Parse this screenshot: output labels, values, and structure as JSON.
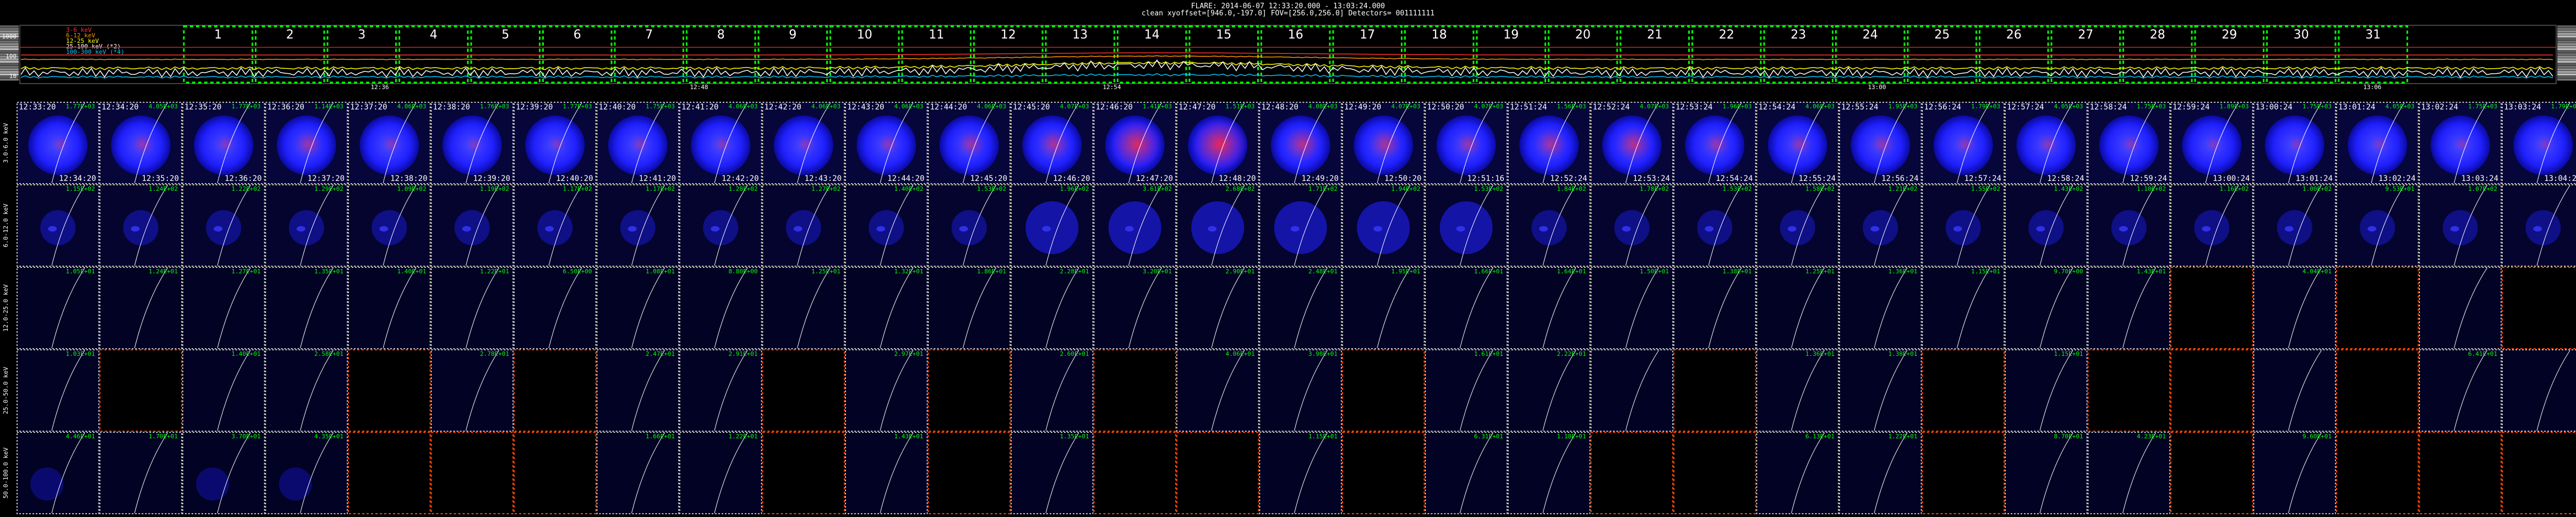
{
  "header": {
    "line1": "FLARE: 2014-06-07 12:33:20.000 - 13:03:24.000",
    "line2": "clean     xyoffset=[946.0,-197.0]    FOV=[256.0,256.0]     Detectors= 001111111"
  },
  "lightcurve": {
    "legend": [
      {
        "label": "3-6 keV",
        "color": "#ff3030"
      },
      {
        "label": "6-12 keV",
        "color": "#ff9000"
      },
      {
        "label": "12-25 keV",
        "color": "#ffff00"
      },
      {
        "label": "25-100 keV (*2)",
        "color": "#ffffff"
      },
      {
        "label": "100-300 keV (*4)",
        "color": "#00c8ff"
      }
    ],
    "y_ticks": [
      "1000",
      "100",
      "10"
    ],
    "x_ticks": [
      "12:36",
      "12:48",
      "12:54",
      "13:00",
      "13:06"
    ],
    "interval_labels": [
      "1",
      "2",
      "3",
      "4",
      "5",
      "6",
      "7",
      "8",
      "9",
      "10",
      "11",
      "12",
      "13",
      "14",
      "15",
      "16",
      "17",
      "18",
      "19",
      "20",
      "21",
      "22",
      "23",
      "24",
      "25",
      "26",
      "27",
      "28",
      "29",
      "30",
      "31"
    ]
  },
  "colors": {
    "interval_box": "#00ff00",
    "map_frame_data": "#ffffff",
    "map_frame_empty": "#ff4500",
    "peak_text": "#00ff00",
    "limb": "#ffffff"
  },
  "rows": [
    {
      "label": "3.0-6.0 keV"
    },
    {
      "label": "6.0-12.0 keV"
    },
    {
      "label": "12.0-25.0 keV"
    },
    {
      "label": "25.0-50.0 keV"
    },
    {
      "label": "50.0-100.0 keV"
    }
  ],
  "columns": [
    {
      "start": "12:33:20",
      "end": "12:34:20",
      "peaks": [
        "1.77E+03",
        "1.15E+02",
        "1.05E+01",
        "1.03E+01",
        "4.46E+01"
      ]
    },
    {
      "start": "12:34:20",
      "end": "12:35:20",
      "peaks": [
        "4.05E+03",
        "1.24E+02",
        "1.24E+01",
        "",
        "1.70E+01"
      ]
    },
    {
      "start": "12:35:20",
      "end": "12:36:20",
      "peaks": [
        "1.77E+03",
        "1.22E+02",
        "1.27E+01",
        "1.40E+01",
        "3.70E+01"
      ]
    },
    {
      "start": "12:36:20",
      "end": "12:37:20",
      "peaks": [
        "1.14E+03",
        "1.29E+02",
        "1.35E+01",
        "2.58E+01",
        "4.35E+01"
      ]
    },
    {
      "start": "12:37:20",
      "end": "12:38:20",
      "peaks": [
        "4.06E+03",
        "1.09E+02",
        "1.40E+01",
        "",
        "2.53E+01"
      ]
    },
    {
      "start": "12:38:20",
      "end": "12:39:20",
      "peaks": [
        "1.76E+03",
        "1.19E+02",
        "1.22E+01",
        "2.78E+01",
        ""
      ]
    },
    {
      "start": "12:39:20",
      "end": "12:40:20",
      "peaks": [
        "1.77E+03",
        "1.17E+02",
        "6.50E+00",
        "",
        ""
      ]
    },
    {
      "start": "12:40:20",
      "end": "12:41:20",
      "peaks": [
        "1.75E+03",
        "1.17E+02",
        "1.08E+01",
        "2.47E+01",
        "1.66E+01"
      ]
    },
    {
      "start": "12:41:20",
      "end": "12:42:20",
      "peaks": [
        "4.06E+03",
        "1.28E+02",
        "8.80E+00",
        "2.91E+01",
        "1.22E+01"
      ]
    },
    {
      "start": "12:42:20",
      "end": "12:43:20",
      "peaks": [
        "4.06E+03",
        "1.27E+02",
        "1.25E+01",
        "",
        ""
      ]
    },
    {
      "start": "12:43:20",
      "end": "12:44:20",
      "peaks": [
        "4.06E+03",
        "1.40E+02",
        "1.32E+01",
        "2.97E+01",
        "1.43E+01"
      ]
    },
    {
      "start": "12:44:20",
      "end": "12:45:20",
      "peaks": [
        "4.06E+03",
        "1.53E+02",
        "1.86E+01",
        "",
        ""
      ]
    },
    {
      "start": "12:45:20",
      "end": "12:46:20",
      "peaks": [
        "4.07E+03",
        "1.96E+02",
        "2.28E+01",
        "2.60E+01",
        "1.35E+01"
      ]
    },
    {
      "start": "12:46:20",
      "end": "12:47:20",
      "peaks": [
        "1.41E+03",
        "3.61E+02",
        "3.20E+01",
        "",
        ""
      ]
    },
    {
      "start": "12:47:20",
      "end": "12:48:20",
      "peaks": [
        "1.51E+03",
        "2.68E+02",
        "2.90E+01",
        "4.06E+01",
        ""
      ]
    },
    {
      "start": "12:48:20",
      "end": "12:49:20",
      "peaks": [
        "4.08E+03",
        "1.71E+02",
        "2.48E+01",
        "3.98E+01",
        "1.15E+01"
      ]
    },
    {
      "start": "12:49:20",
      "end": "12:50:20",
      "peaks": [
        "4.07E+03",
        "1.94E+02",
        "1.95E+01",
        "",
        ""
      ]
    },
    {
      "start": "12:50:20",
      "end": "12:51:16",
      "peaks": [
        "4.07E+03",
        "1.53E+02",
        "1.66E+01",
        "1.61E+01",
        "6.31E+01"
      ]
    },
    {
      "start": "12:51:24",
      "end": "12:52:24",
      "peaks": [
        "1.56E+03",
        "1.84E+02",
        "1.64E+01",
        "2.22E+01",
        "1.18E+01"
      ]
    },
    {
      "start": "12:52:24",
      "end": "12:53:24",
      "peaks": [
        "4.07E+03",
        "1.78E+02",
        "1.50E+01",
        "",
        ""
      ]
    },
    {
      "start": "12:53:24",
      "end": "12:54:24",
      "peaks": [
        "1.96E+03",
        "1.53E+02",
        "1.38E+01",
        "1.40E+01",
        ""
      ]
    },
    {
      "start": "12:54:24",
      "end": "12:55:24",
      "peaks": [
        "4.06E+03",
        "1.58E+02",
        "1.25E+01",
        "1.36E+01",
        "6.13E+01"
      ]
    },
    {
      "start": "12:55:24",
      "end": "12:56:24",
      "peaks": [
        "1.95E+03",
        "1.21E+02",
        "1.36E+01",
        "1.38E+01",
        "1.22E+01"
      ]
    },
    {
      "start": "12:56:24",
      "end": "12:57:24",
      "peaks": [
        "1.79E+03",
        "1.55E+02",
        "1.15E+01",
        "",
        ""
      ]
    },
    {
      "start": "12:57:24",
      "end": "12:58:24",
      "peaks": [
        "4.05E+03",
        "1.43E+02",
        "9.70E+00",
        "1.15E+01",
        "8.70E+01"
      ]
    },
    {
      "start": "12:58:24",
      "end": "12:59:24",
      "peaks": [
        "1.75E+03",
        "1.10E+02",
        "1.43E+01",
        "",
        "4.23E+01"
      ]
    },
    {
      "start": "12:59:24",
      "end": "13:00:24",
      "peaks": [
        "1.89E+03",
        "1.16E+02",
        "",
        "",
        ""
      ]
    },
    {
      "start": "13:00:24",
      "end": "13:01:24",
      "peaks": [
        "1.75E+03",
        "1.00E+02",
        "4.04E+01",
        "",
        "9.60E+01"
      ]
    },
    {
      "start": "13:01:24",
      "end": "13:02:24",
      "peaks": [
        "4.05E+03",
        "9.53E+01",
        "",
        "",
        ""
      ]
    },
    {
      "start": "13:02:24",
      "end": "13:03:24",
      "peaks": [
        "1.75E+03",
        "1.07E+02",
        "",
        "6.41E+01",
        ""
      ]
    },
    {
      "start": "13:03:24",
      "end": "13:04:24",
      "peaks": [
        "1.79E+03",
        "",
        "",
        "",
        ""
      ]
    }
  ],
  "empty_cells": [
    [
      26,
      2
    ],
    [
      28,
      2
    ],
    [
      30,
      2
    ],
    [
      1,
      3
    ],
    [
      4,
      3
    ],
    [
      6,
      3
    ],
    [
      9,
      3
    ],
    [
      11,
      3
    ],
    [
      13,
      3
    ],
    [
      16,
      3
    ],
    [
      20,
      3
    ],
    [
      23,
      3
    ],
    [
      25,
      3
    ],
    [
      26,
      3
    ],
    [
      28,
      3
    ],
    [
      4,
      4
    ],
    [
      5,
      4
    ],
    [
      6,
      4
    ],
    [
      9,
      4
    ],
    [
      11,
      4
    ],
    [
      13,
      4
    ],
    [
      14,
      4
    ],
    [
      16,
      4
    ],
    [
      19,
      4
    ],
    [
      20,
      4
    ],
    [
      23,
      4
    ],
    [
      26,
      4
    ],
    [
      28,
      4
    ],
    [
      29,
      4
    ],
    [
      30,
      4
    ]
  ],
  "red_blob_intensity": [
    0.15,
    0.3,
    0.2,
    0.4,
    0.2,
    0.15,
    0.15,
    0.2,
    0.2,
    0.2,
    0.25,
    0.4,
    0.5,
    0.9,
    1.0,
    0.6,
    0.5,
    0.35,
    0.5,
    0.6,
    0.35,
    0.3,
    0.3,
    0.25,
    0.25,
    0.2,
    0.15,
    0.15,
    0.15,
    0.15,
    0.15
  ]
}
